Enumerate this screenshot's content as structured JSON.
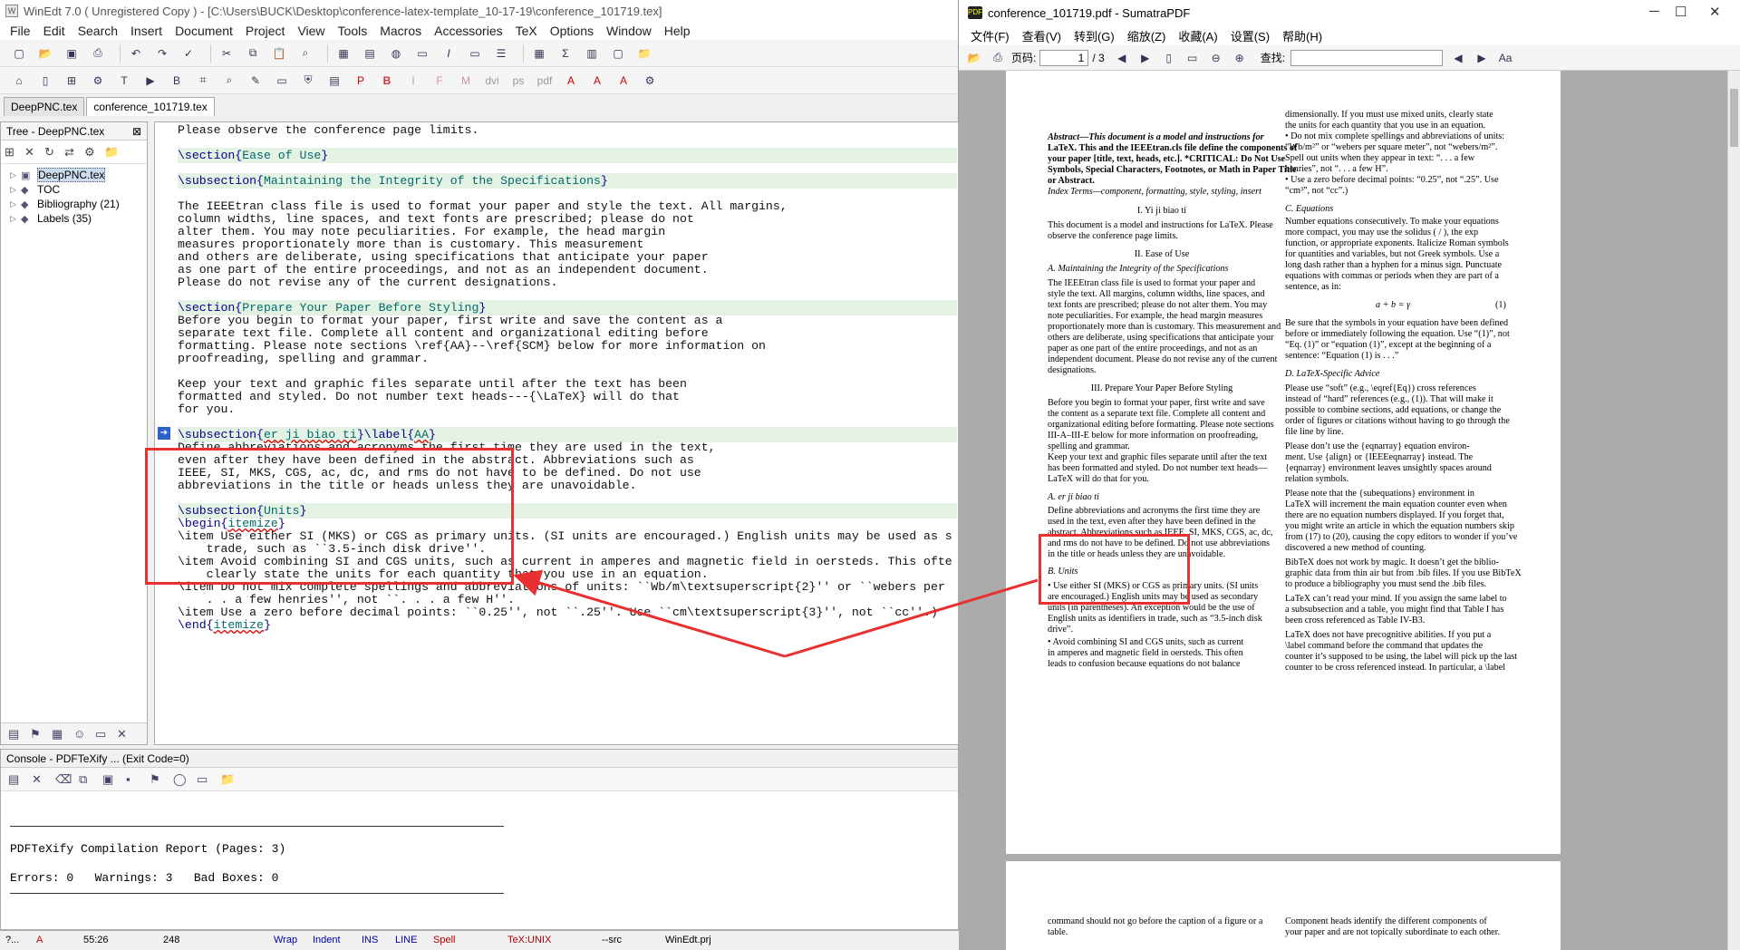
{
  "winedt": {
    "title": "WinEdt 7.0  ( Unregistered  Copy )  - [C:\\Users\\BUCK\\Desktop\\conference-latex-template_10-17-19\\conference_101719.tex]",
    "menu": [
      "File",
      "Edit",
      "Search",
      "Insert",
      "Document",
      "Project",
      "View",
      "Tools",
      "Macros",
      "Accessories",
      "TeX",
      "Options",
      "Window",
      "Help"
    ],
    "tabs": [
      "DeepPNC.tex",
      "conference_101719.tex"
    ],
    "tree": {
      "title": "Tree - DeepPNC.tex",
      "items": [
        {
          "label": "DeepPNC.tex",
          "icon": "tex-file-icon"
        },
        {
          "label": "TOC",
          "icon": "toc-icon"
        },
        {
          "label": "Bibliography  (21)",
          "icon": "bibliography-icon"
        },
        {
          "label": "Labels  (35)",
          "icon": "labels-icon"
        }
      ]
    },
    "console": {
      "title": "Console - PDFTeXify ... (Exit Code=0)",
      "report": "PDFTeXify Compilation Report (Pages: 3)",
      "summary": "Errors: 0   Warnings: 3   Bad Boxes: 0"
    },
    "status": {
      "position": "55:26",
      "count": "248",
      "wrap": "Wrap",
      "indent": "Indent",
      "ins": "INS",
      "line": "LINE",
      "spell": "Spell",
      "mode": "TeX:UNIX",
      "src": "--src",
      "project": "WinEdt.prj",
      "help": "?...",
      "flag": "A"
    }
  },
  "editor_lines": {
    "l01": "Please observe the conference page limits.",
    "l03a": "\\section{",
    "l03b": "Ease of Use",
    "l03c": "}",
    "l05a": "\\subsection{",
    "l05b": "Maintaining the Integrity of the Specifications",
    "l05c": "}",
    "l07": "The IEEEtran class file is used to format your paper and style the text. All margins,",
    "l08": "column widths, line spaces, and text fonts are prescribed; please do not",
    "l09": "alter them. You may note peculiarities. For example, the head margin",
    "l10": "measures proportionately more than is customary. This measurement",
    "l11": "and others are deliberate, using specifications that anticipate your paper",
    "l12": "as one part of the entire proceedings, and not as an independent document.",
    "l13": "Please do not revise any of the current designations.",
    "l15a": "\\section{",
    "l15b": "Prepare Your Paper Before Styling",
    "l15c": "}",
    "l16": "Before you begin to format your paper, first write and save the content as a",
    "l17": "separate text file. Complete all content and organizational editing before",
    "l18": "formatting. Please note sections \\ref{AA}--\\ref{SCM} below for more information on",
    "l19": "proofreading, spelling and grammar.",
    "l21": "Keep your text and graphic files separate until after the text has been",
    "l22": "formatted and styled. Do not number text heads---{\\LaTeX} will do that",
    "l23": "for you.",
    "l25a": "\\subsection{",
    "l25b": "er ji biao ti",
    "l25c": "}\\label{",
    "l25d": "AA",
    "l25e": "}",
    "l26": "Define abbreviations and acronyms the first time they are used in the text,",
    "l27": "even after they have been defined in the abstract. Abbreviations such as",
    "l28": "IEEE, SI, MKS, CGS, ac, dc, and rms do not have to be defined. Do not use",
    "l29": "abbreviations in the title or heads unless they are unavoidable.",
    "l31a": "\\subsection{",
    "l31b": "Units",
    "l31c": "}",
    "l32a": "\\begin{",
    "l32b": "itemize",
    "l32c": "}",
    "l33": "\\item Use either SI (MKS) or CGS as primary units. (SI units are encouraged.) English units may be used as s",
    "l34": "    trade, such as ``3.5-inch disk drive''.",
    "l35": "\\item Avoid combining SI and CGS units, such as current in amperes and magnetic field in oersteds. This ofte",
    "l36": "    clearly state the units for each quantity that you use in an equation.",
    "l37": "\\item Do not mix complete spellings and abbreviations of units: ``Wb/m\\textsuperscript{2}'' or ``webers per",
    "l38": "    . . a few henries'', not ``. . . a few H''.",
    "l39": "\\item Use a zero before decimal points: ``0.25'', not ``.25''. Use ``cm\\textsuperscript{3}'', not ``cc''.)",
    "l40a": "\\end{",
    "l40b": "itemize",
    "l40c": "}"
  },
  "sumatra": {
    "title": "conference_101719.pdf - SumatraPDF",
    "menu": [
      "文件(F)",
      "查看(V)",
      "转到(G)",
      "缩放(Z)",
      "收藏(A)",
      "设置(S)",
      "帮助(H)"
    ],
    "page_label": "页码:",
    "page_value": "1",
    "page_total": "/ 3",
    "find_label": "查找:"
  },
  "pdf": {
    "left": [
      "Abstract—This document is a model and instructions for",
      "LaTeX. This and the IEEEtran.cls file define the components of",
      "your paper [title, text, heads, etc.]. *CRITICAL: Do Not Use",
      "Symbols, Special Characters, Footnotes, or Math in Paper Title",
      "or Abstract.",
      "Index Terms—component, formatting, style, styling, insert",
      "I.  Yi ji biao ti",
      "This document is a model and instructions for LaTeX. Please",
      "observe the conference page limits.",
      "II.  Ease of Use",
      "A.  Maintaining the Integrity of the Specifications",
      "The IEEEtran class file is used to format your paper and",
      "style the text. All margins, column widths, line spaces, and",
      "text fonts are prescribed; please do not alter them. You may",
      "note peculiarities. For example, the head margin measures",
      "proportionately more than is customary. This measurement and",
      "others are deliberate, using specifications that anticipate your",
      "paper as one part of the entire proceedings, and not as an",
      "independent document. Please do not revise any of the current",
      "designations.",
      "III.  Prepare Your Paper Before Styling",
      "Before you begin to format your paper, first write and save",
      "the content as a separate text file. Complete all content and",
      "organizational editing before formatting. Please note sections",
      "III-A–III-E below for more information on proofreading,",
      "spelling and grammar.",
      "Keep your text and graphic files separate until after the text",
      "has been formatted and styled. Do not number text heads—",
      "LaTeX will do that for you.",
      "A.  er ji biao ti",
      "Define abbreviations and acronyms the first time they are",
      "used in the text, even after they have been defined in the",
      "abstract. Abbreviations such as IEEE, SI, MKS, CGS, ac, dc,",
      "and rms do not have to be defined. Do not use abbreviations",
      "in the title or heads unless they are unavoidable.",
      "B.  Units",
      "•  Use either SI (MKS) or CGS as primary units. (SI units",
      "   are encouraged.) English units may be used as secondary",
      "   units (in parentheses). An exception would be the use of",
      "   English units as identifiers in trade, such as “3.5-inch disk",
      "   drive”.",
      "•  Avoid combining SI and CGS units, such as current",
      "   in amperes and magnetic field in oersteds. This often",
      "   leads to confusion because equations do not balance"
    ],
    "right": [
      "dimensionally. If you must use mixed units, clearly state",
      "the units for each quantity that you use in an equation.",
      "•  Do not mix complete spellings and abbreviations of units:",
      "   “Wb/m²” or “webers per square meter”, not “webers/m²”.",
      "   Spell out units when they appear in text: “. . . a few",
      "   henries”, not “. . . a few H”.",
      "•  Use a zero before decimal points: “0.25”, not “.25”. Use",
      "   “cm³”, not “cc”.)",
      "C.  Equations",
      "Number equations consecutively. To make your equations",
      "more compact, you may use the solidus ( / ), the exp",
      "function, or appropriate exponents. Italicize Roman symbols",
      "for quantities and variables, but not Greek symbols. Use a",
      "long dash rather than a hyphen for a minus sign. Punctuate",
      "equations with commas or periods when they are part of a",
      "sentence, as in:",
      "a + b = γ",
      "(1)",
      "Be sure that the symbols in your equation have been defined",
      "before or immediately following the equation. Use “(1)”, not",
      "“Eq. (1)” or “equation (1)”, except at the beginning of a",
      "sentence: “Equation (1) is . . .”",
      "D.  LaTeX-Specific Advice",
      "Please use “soft” (e.g., \\eqref{Eq}) cross references",
      "instead of “hard” references (e.g., (1)). That will make it",
      "possible to combine sections, add equations, or change the",
      "order of figures or citations without having to go through the",
      "file line by line.",
      "Please don’t use the {eqnarray} equation environ-",
      "ment. Use {align} or {IEEEeqnarray} instead. The",
      "{eqnarray} environment leaves unsightly spaces around",
      "relation symbols.",
      "Please note that the {subequations} environment in",
      "LaTeX will increment the main equation counter even when",
      "there are no equation numbers displayed. If you forget that,",
      "you might write an article in which the equation numbers skip",
      "from (17) to (20), causing the copy editors to wonder if you’ve",
      "discovered a new method of counting.",
      "BibTeX does not work by magic. It doesn’t get the biblio-",
      "graphic data from thin air but from .bib files. If you use BibTeX",
      "to produce a bibliography you must send the .bib files.",
      "LaTeX can’t read your mind. If you assign the same label to",
      "a subsubsection and a table, you might find that Table I has",
      "been cross referenced as Table IV-B3.",
      "LaTeX does not have precognitive abilities. If you put a",
      "\\label command before the command that updates the",
      "counter it’s supposed to be using, the label will pick up the last",
      "counter to be cross referenced instead. In particular, a \\label"
    ],
    "page2_left": [
      "command should not go before the caption of a figure or a",
      "table."
    ],
    "page2_right": [
      "Component heads identify the different components of",
      "your paper and are not topically subordinate to each other."
    ]
  }
}
